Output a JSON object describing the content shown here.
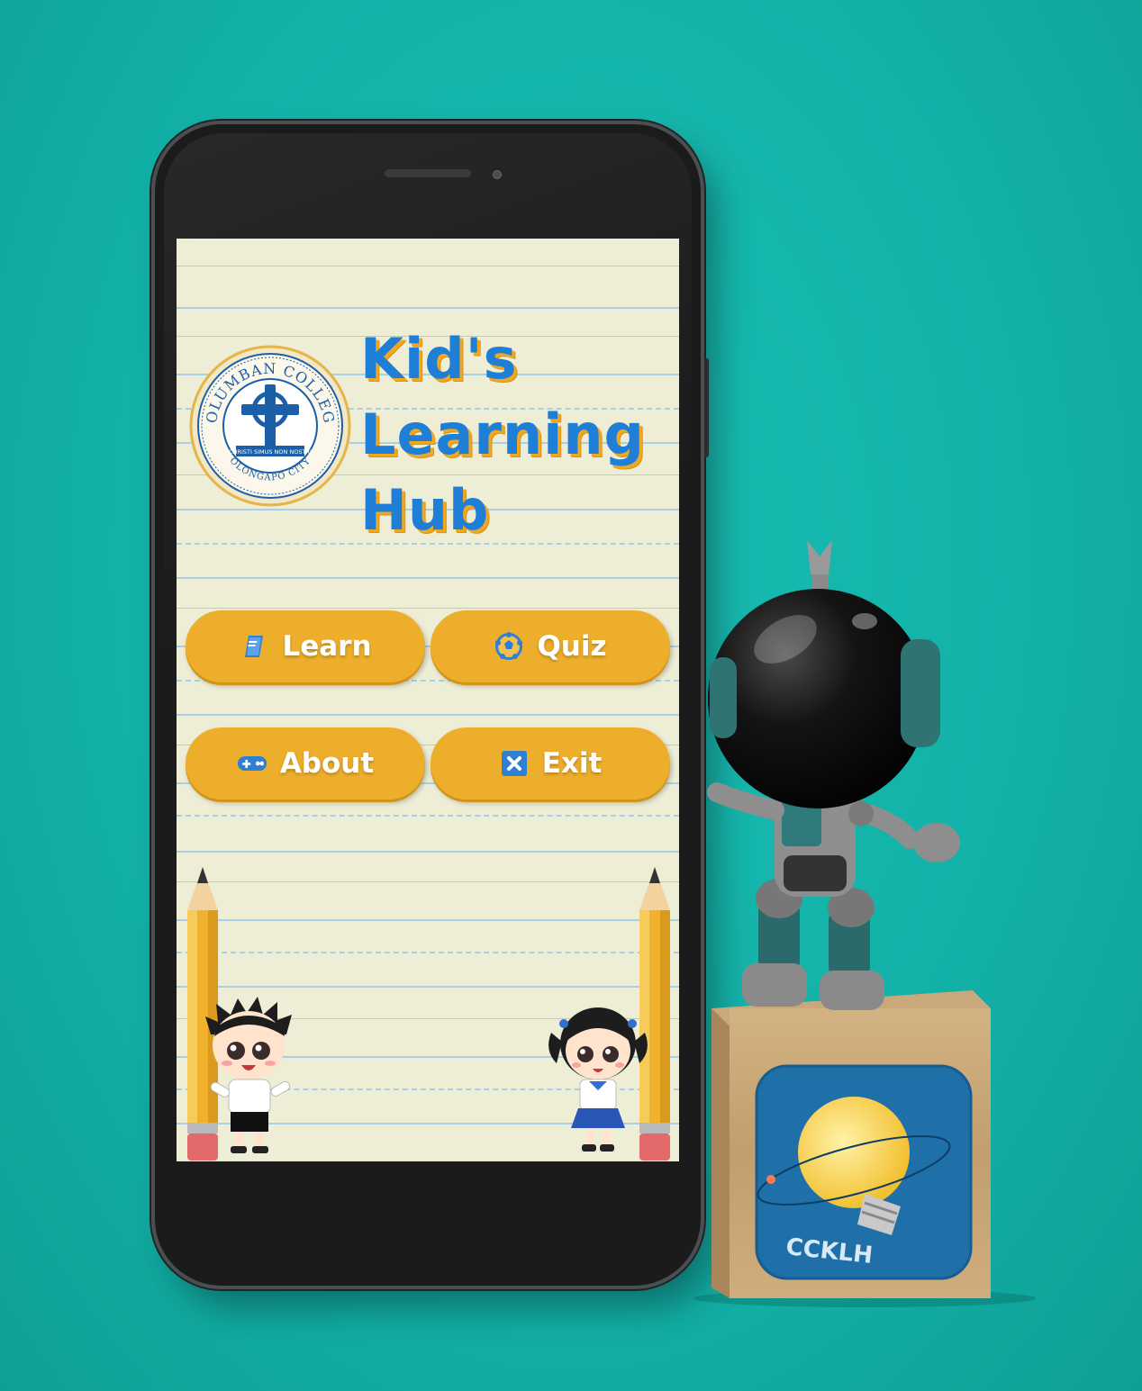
{
  "app": {
    "title_lines": [
      "Kid's",
      "Learning",
      "Hub"
    ],
    "logo": {
      "name": "COLUMBAN COLLEGE",
      "motto": "CHRISTI SIMUS NON NOSTRI",
      "city": "OLONGAPO CITY"
    }
  },
  "menu": {
    "learn": {
      "label": "Learn",
      "icon": "book-icon"
    },
    "quiz": {
      "label": "Quiz",
      "icon": "ball-icon"
    },
    "about": {
      "label": "About",
      "icon": "gamepad-icon"
    },
    "exit": {
      "label": "Exit",
      "icon": "close-icon"
    }
  },
  "cube": {
    "app_icon_label": "CCKLH"
  },
  "colors": {
    "background": "#13b2a9",
    "button": "#edae2c",
    "title": "#1f7fd6",
    "title_shadow": "#f0a91f",
    "paper": "#eeedd5"
  }
}
